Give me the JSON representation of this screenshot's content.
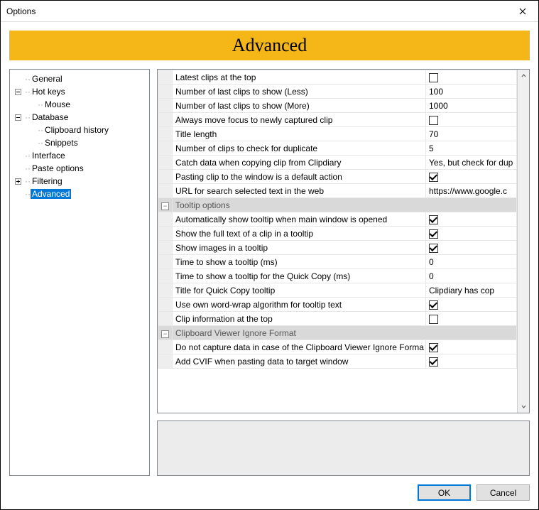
{
  "window": {
    "title": "Options"
  },
  "banner": {
    "title": "Advanced"
  },
  "tree": {
    "items": [
      {
        "label": "General",
        "depth": 1,
        "expander": "none"
      },
      {
        "label": "Hot keys",
        "depth": 1,
        "expander": "minus"
      },
      {
        "label": "Mouse",
        "depth": 2,
        "expander": "none"
      },
      {
        "label": "Database",
        "depth": 1,
        "expander": "minus"
      },
      {
        "label": "Clipboard history",
        "depth": 2,
        "expander": "none"
      },
      {
        "label": "Snippets",
        "depth": 2,
        "expander": "none"
      },
      {
        "label": "Interface",
        "depth": 1,
        "expander": "none"
      },
      {
        "label": "Paste options",
        "depth": 1,
        "expander": "none"
      },
      {
        "label": "Filtering",
        "depth": 1,
        "expander": "plus"
      },
      {
        "label": "Advanced",
        "depth": 1,
        "expander": "none",
        "selected": true
      }
    ]
  },
  "grid": {
    "rows": [
      {
        "type": "prop",
        "label": "Latest clips at the top",
        "value_type": "check",
        "checked": false
      },
      {
        "type": "prop",
        "label": "Number of last clips to show (Less)",
        "value_type": "text",
        "value": "100"
      },
      {
        "type": "prop",
        "label": "Number of last clips to show (More)",
        "value_type": "text",
        "value": "1000"
      },
      {
        "type": "prop",
        "label": "Always move focus to newly captured clip",
        "value_type": "check",
        "checked": false
      },
      {
        "type": "prop",
        "label": "Title length",
        "value_type": "text",
        "value": "70"
      },
      {
        "type": "prop",
        "label": "Number of clips to check for duplicate",
        "value_type": "text",
        "value": "5"
      },
      {
        "type": "prop",
        "label": "Catch data when copying clip from Clipdiary",
        "value_type": "text",
        "value": "Yes, but check for dup"
      },
      {
        "type": "prop",
        "label": "Pasting clip to the window is a default action",
        "value_type": "check",
        "checked": true
      },
      {
        "type": "prop",
        "label": "URL for search selected text in the web",
        "value_type": "text",
        "value": "https://www.google.c"
      },
      {
        "type": "group",
        "label": "Tooltip options"
      },
      {
        "type": "prop",
        "label": "Automatically show tooltip when main window is opened",
        "value_type": "check",
        "checked": true
      },
      {
        "type": "prop",
        "label": "Show the full text of a clip in a tooltip",
        "value_type": "check",
        "checked": true
      },
      {
        "type": "prop",
        "label": "Show images in a tooltip",
        "value_type": "check",
        "checked": true
      },
      {
        "type": "prop",
        "label": "Time to show a tooltip (ms)",
        "value_type": "text",
        "value": "0"
      },
      {
        "type": "prop",
        "label": "Time to show a tooltip for the Quick Copy (ms)",
        "value_type": "text",
        "value": "0"
      },
      {
        "type": "prop",
        "label": "Title for Quick Copy tooltip",
        "value_type": "text",
        "value": "      Clipdiary has cop"
      },
      {
        "type": "prop",
        "label": "Use own word-wrap algorithm for tooltip text",
        "value_type": "check",
        "checked": true
      },
      {
        "type": "prop",
        "label": "Clip information at the top",
        "value_type": "check",
        "checked": false
      },
      {
        "type": "group",
        "label": "Clipboard Viewer Ignore Format"
      },
      {
        "type": "prop",
        "label": "Do not capture data in case of the Clipboard Viewer Ignore Forma",
        "value_type": "check",
        "checked": true
      },
      {
        "type": "prop",
        "label": "Add CVIF when pasting data to target window",
        "value_type": "check",
        "checked": true
      }
    ]
  },
  "buttons": {
    "ok": "OK",
    "cancel": "Cancel"
  }
}
